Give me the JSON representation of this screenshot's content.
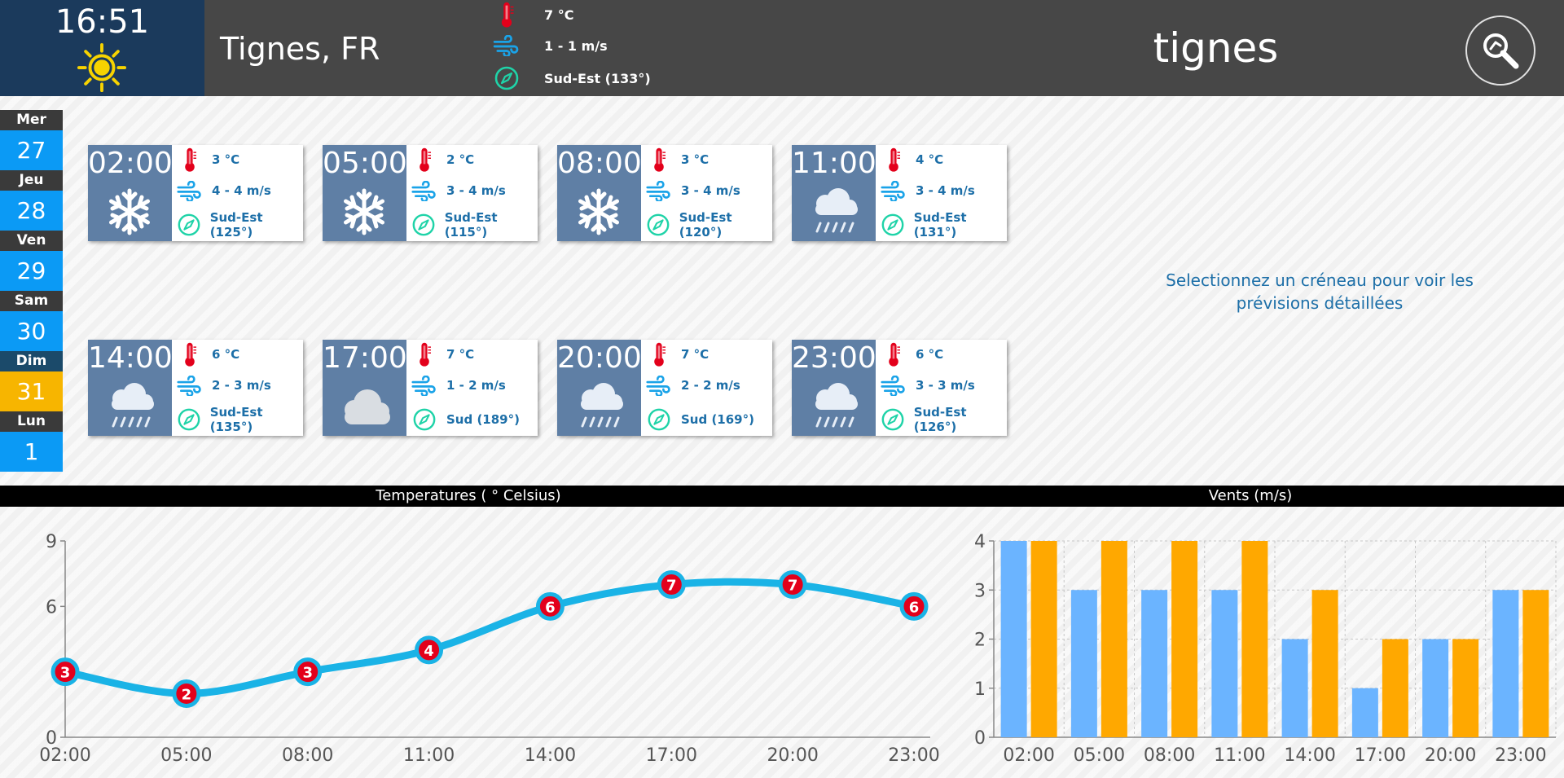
{
  "header": {
    "clock": "16:51",
    "clock_icon": "sun-icon",
    "city": "Tignes, FR",
    "current": {
      "temperature": "7 °C",
      "wind": "1 - 1 m/s",
      "direction": "Sud-Est (133°)"
    },
    "search_query": "tignes",
    "search_icon": "search-icon"
  },
  "days": [
    {
      "name": "Mer",
      "num": "27",
      "selected": false
    },
    {
      "name": "Jeu",
      "num": "28",
      "selected": false
    },
    {
      "name": "Ven",
      "num": "29",
      "selected": false
    },
    {
      "name": "Sam",
      "num": "30",
      "selected": false
    },
    {
      "name": "Dim",
      "num": "31",
      "selected": true
    },
    {
      "name": "Lun",
      "num": "1",
      "selected": false
    }
  ],
  "slots": [
    {
      "time": "02:00",
      "icon": "snow-icon",
      "temp": "3 °C",
      "wind": "4 - 4 m/s",
      "dir": "Sud-Est (125°)"
    },
    {
      "time": "05:00",
      "icon": "snow-icon",
      "temp": "2 °C",
      "wind": "3 - 4 m/s",
      "dir": "Sud-Est (115°)"
    },
    {
      "time": "08:00",
      "icon": "snow-icon",
      "temp": "3 °C",
      "wind": "3 - 4 m/s",
      "dir": "Sud-Est (120°)"
    },
    {
      "time": "11:00",
      "icon": "rain-icon",
      "temp": "4 °C",
      "wind": "3 - 4 m/s",
      "dir": "Sud-Est (131°)"
    },
    {
      "time": "14:00",
      "icon": "rain-icon",
      "temp": "6 °C",
      "wind": "2 - 3 m/s",
      "dir": "Sud-Est (135°)"
    },
    {
      "time": "17:00",
      "icon": "cloud-icon",
      "temp": "7 °C",
      "wind": "1 - 2 m/s",
      "dir": "Sud (189°)"
    },
    {
      "time": "20:00",
      "icon": "rain-icon",
      "temp": "7 °C",
      "wind": "2 - 2 m/s",
      "dir": "Sud (169°)"
    },
    {
      "time": "23:00",
      "icon": "rain-icon",
      "temp": "6 °C",
      "wind": "3 - 3 m/s",
      "dir": "Sud-Est (126°)"
    }
  ],
  "hint": "Selectionnez un créneau pour voir les prévisions détaillées",
  "colors": {
    "accent_blue": "#0b9af5",
    "selected_day": "#f7b500",
    "line": "#1ab3e6",
    "marker": "#e3001b",
    "bar_min": "#6bb4ff",
    "bar_max": "#ffa800",
    "card_text": "#1d6fa8"
  },
  "chart_data": [
    {
      "type": "line",
      "title": "Temperatures ( ° Celsius)",
      "x": [
        "02:00",
        "05:00",
        "08:00",
        "11:00",
        "14:00",
        "17:00",
        "20:00",
        "23:00"
      ],
      "series": [
        {
          "values": [
            3,
            2,
            3,
            4,
            6,
            7,
            7,
            6
          ]
        }
      ],
      "ylim": [
        0,
        9
      ],
      "yticks": [
        0,
        6,
        9
      ],
      "grid": false,
      "point_labels": true
    },
    {
      "type": "bar",
      "title": "Vents (m/s)",
      "categories": [
        "02:00",
        "05:00",
        "08:00",
        "11:00",
        "14:00",
        "17:00",
        "20:00",
        "23:00"
      ],
      "series": [
        {
          "values": [
            4,
            3,
            3,
            3,
            2,
            1,
            2,
            3
          ]
        },
        {
          "values": [
            4,
            4,
            4,
            4,
            3,
            2,
            2,
            3
          ]
        }
      ],
      "ylim": [
        0,
        4
      ],
      "yticks": [
        0,
        1,
        2,
        3,
        4
      ],
      "grid": true
    }
  ]
}
